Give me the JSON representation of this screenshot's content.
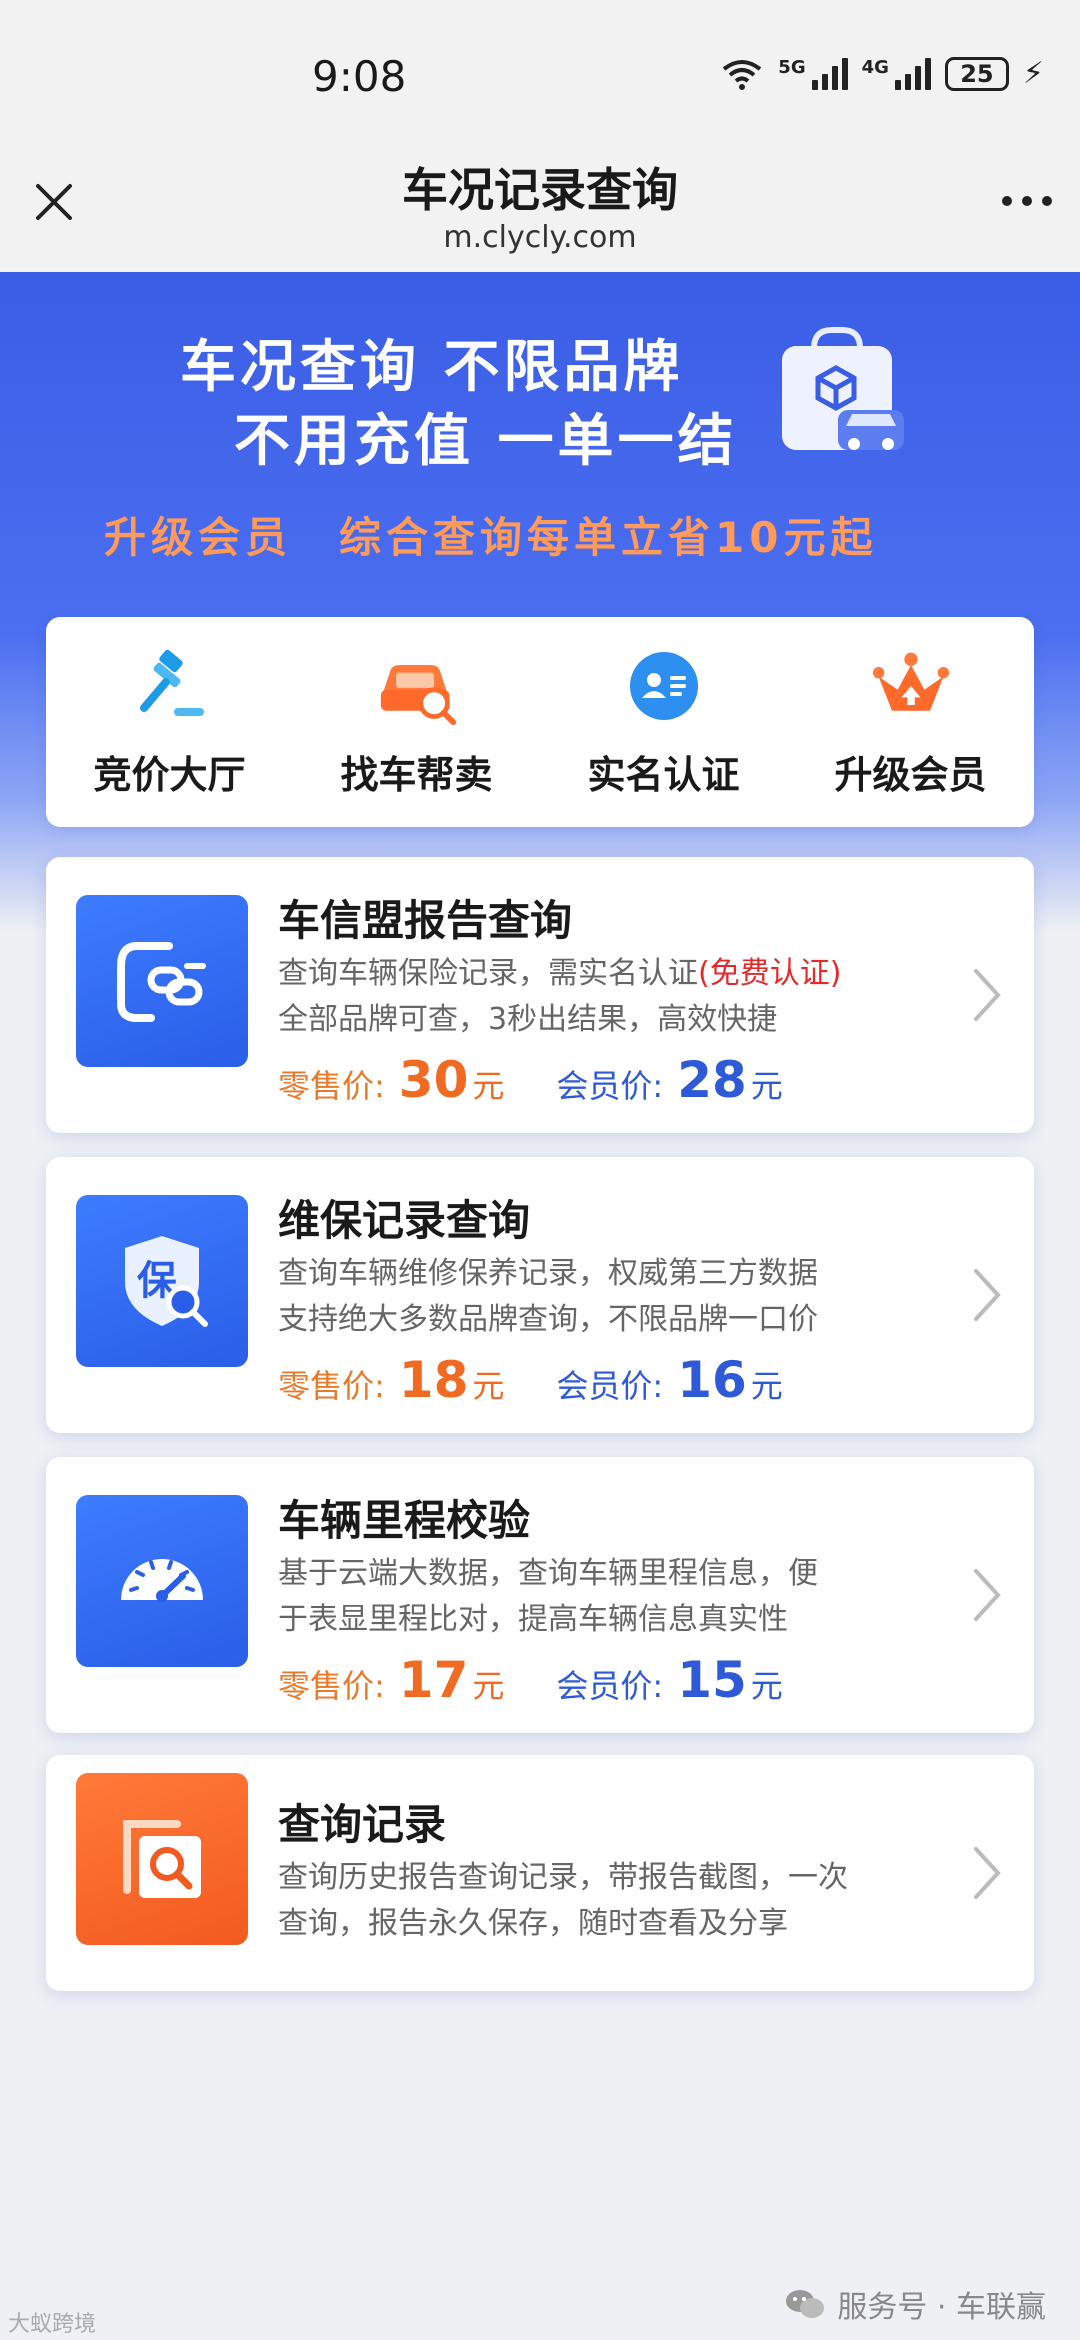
{
  "status_bar": {
    "time": "9:08",
    "signal_labels": [
      "5G",
      "4G"
    ],
    "battery": "25"
  },
  "header": {
    "title": "车况记录查询",
    "url": "m.clycly.com"
  },
  "banner": {
    "line1": "车况查询 不限品牌",
    "line2": "不用充值 一单一结",
    "promo": "升级会员　综合查询每单立省10元起"
  },
  "quick_nav": [
    {
      "label": "竞价大厅",
      "icon": "auction-hammer-icon"
    },
    {
      "label": "找车帮卖",
      "icon": "car-search-icon"
    },
    {
      "label": "实名认证",
      "icon": "id-card-icon"
    },
    {
      "label": "升级会员",
      "icon": "crown-icon"
    }
  ],
  "cards": [
    {
      "title": "车信盟报告查询",
      "desc1_pre": "查询车辆保险记录，需实名认证",
      "desc1_tag": "(免费认证)",
      "desc2": "全部品牌可查，3秒出结果，高效快捷",
      "retail_label": "零售价:",
      "retail_price": "30",
      "member_label": "会员价:",
      "member_price": "28",
      "unit": "元",
      "icon": "car-link-icon"
    },
    {
      "title": "维保记录查询",
      "desc1": "查询车辆维修保养记录，权威第三方数据",
      "desc2": "支持绝大多数品牌查询，不限品牌一口价",
      "retail_label": "零售价:",
      "retail_price": "18",
      "member_label": "会员价:",
      "member_price": "16",
      "unit": "元",
      "icon": "shield-search-icon",
      "icon_text": "保"
    },
    {
      "title": "车辆里程校验",
      "desc1": "基于云端大数据，查询车辆里程信息，便",
      "desc2": "于表显里程比对，提高车辆信息真实性",
      "retail_label": "零售价:",
      "retail_price": "17",
      "member_label": "会员价:",
      "member_price": "15",
      "unit": "元",
      "icon": "speedometer-icon"
    },
    {
      "title": "查询记录",
      "desc1": "查询历史报告查询记录，带报告截图，一次",
      "desc2": "查询，报告永久保存，随时查看及分享",
      "icon": "document-search-icon"
    }
  ],
  "footer": {
    "watermark_left": "大蚁跨境",
    "watermark_right": "服务号 · 车联赢"
  }
}
